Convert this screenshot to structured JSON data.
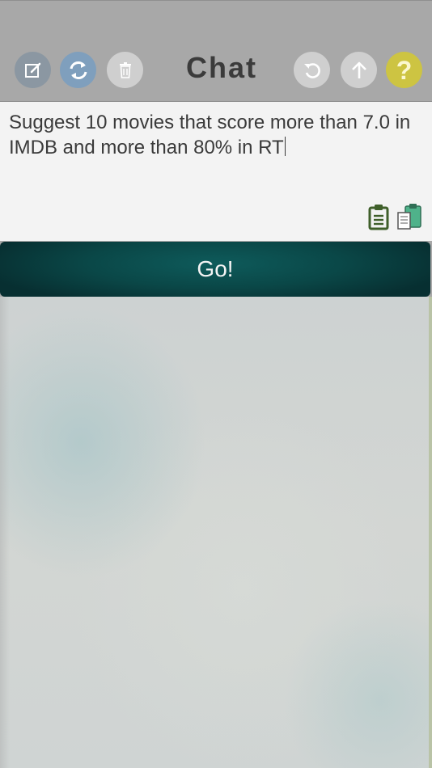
{
  "header": {
    "title": "Chat",
    "help_glyph": "?",
    "buttons": [
      {
        "name": "edit",
        "icon": "edit-icon",
        "color": "#8b97a2"
      },
      {
        "name": "refresh",
        "icon": "refresh-icon",
        "color": "#7f9fbd"
      },
      {
        "name": "trash",
        "icon": "trash-icon",
        "color": "#cfcfcf"
      },
      {
        "name": "undo",
        "icon": "undo-icon",
        "color": "#cfcfcf"
      },
      {
        "name": "upload",
        "icon": "arrow-up-icon",
        "color": "#cfcfcf"
      },
      {
        "name": "help",
        "icon": "question-icon",
        "color": "#cdc442"
      }
    ]
  },
  "prompt": {
    "value": "Suggest 10 movies that score more than 7.0 in IMDB and more than 80% in RT",
    "copy_icon": "clipboard-copy-icon",
    "paste_icon": "clipboard-paste-icon"
  },
  "go_button": {
    "label": "Go!",
    "color": "#0a4747"
  },
  "colors": {
    "header_bg": "#a8a8a8",
    "input_bg": "#f3f3f3",
    "accent_teal": "#0a4747",
    "help_yellow": "#cdc442"
  }
}
